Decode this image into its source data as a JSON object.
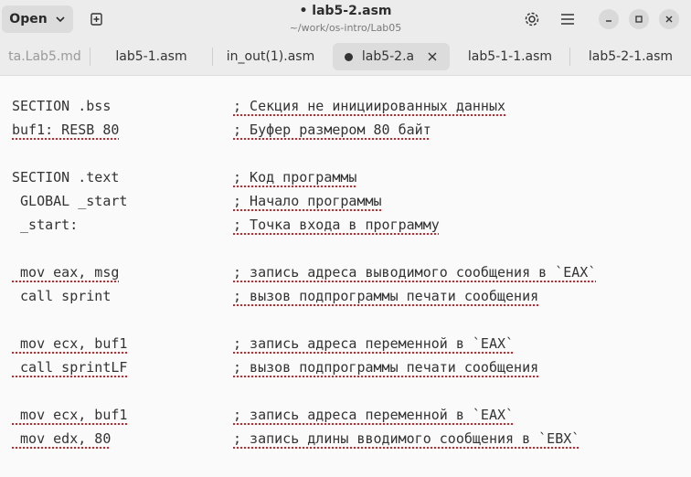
{
  "window": {
    "title": "• lab5-2.asm",
    "path": "~/work/os-intro/Lab05"
  },
  "toolbar": {
    "open_label": "Open"
  },
  "tabs": [
    {
      "label": "ta.Lab5.md"
    },
    {
      "label": "lab5-1.asm"
    },
    {
      "label": "in_out(1).asm"
    },
    {
      "label": "lab5-2.a",
      "active": true,
      "modified": true
    },
    {
      "label": "lab5-1-1.asm"
    },
    {
      "label": "lab5-2-1.asm"
    }
  ],
  "editor": {
    "lines": [
      {
        "code": "SECTION .bss",
        "comment": "; Секция не инициированных данных"
      },
      {
        "code": "buf1: RESB 80",
        "comment": "; Буфер размером 80 байт"
      },
      {
        "code": "",
        "comment": ""
      },
      {
        "code": "SECTION .text",
        "comment": "; Код программы"
      },
      {
        "code": " GLOBAL _start",
        "comment": "; Начало программы"
      },
      {
        "code": " _start:",
        "comment": "; Точка входа в программу"
      },
      {
        "code": "",
        "comment": ""
      },
      {
        "code": " mov eax, msg",
        "comment": "; запись адреса выводимого сообщения в `EAX`"
      },
      {
        "code": " call sprint",
        "comment": "; вызов подпрограммы печати сообщения"
      },
      {
        "code": "",
        "comment": ""
      },
      {
        "code": " mov ecx, buf1",
        "comment": "; запись адреса переменной в `EAX`"
      },
      {
        "code": " call sprintLF",
        "comment": "; вызов подпрограммы печати сообщения"
      },
      {
        "code": "",
        "comment": ""
      },
      {
        "code": " mov ecx, buf1",
        "comment": "; запись адреса переменной в `EAX`"
      },
      {
        "code": " mov edx, 80",
        "comment": "; запись длины вводимого сообщения в `EBX`"
      }
    ]
  }
}
